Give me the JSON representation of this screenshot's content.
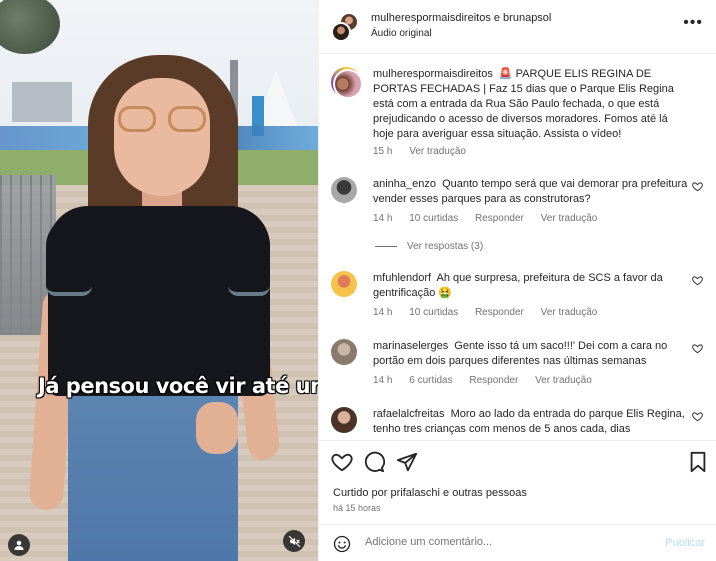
{
  "video": {
    "caption": "Já pensou você vir até um"
  },
  "header": {
    "names": "mulherespormaisdireitos e brunapsol",
    "audio": "Áudio original"
  },
  "post": {
    "username": "mulherespormaisdireitos",
    "caption": "🚨 PARQUE ELIS REGINA DE PORTAS FECHADAS | Faz 15 dias que o Parque Elis Regina está com a entrada da Rua São Paulo fechada, o que está prejudicando o acesso de diversos moradores. Fomos até lá hoje para averiguar essa situação. Assista o vídeo!",
    "time": "15 h",
    "translate": "Ver tradução"
  },
  "comments": [
    {
      "username": "aninha_enzo",
      "text": "Quanto tempo será que vai demorar pra prefeitura vender esses parques para as construtoras?",
      "time": "14 h",
      "likes": "10 curtidas",
      "reply": "Responder",
      "translate": "Ver tradução",
      "replies": "Ver respostas (3)"
    },
    {
      "username": "mfuhlendorf",
      "text": "Ah que surpresa, prefeitura de SCS a favor da gentrificação 🤮",
      "time": "14 h",
      "likes": "10 curtidas",
      "reply": "Responder",
      "translate": "Ver tradução"
    },
    {
      "username": "marinaselerges",
      "text": "Gente isso tá um saco!!!' Dei com a cara no portão em dois parques diferentes nas últimas semanas",
      "time": "14 h",
      "likes": "6 curtidas",
      "reply": "Responder",
      "translate": "Ver tradução"
    },
    {
      "username": "rafaelalcfreitas",
      "text": "Moro ao lado da entrada do parque Elis Regina, tenho tres crianças com menos de 5 anos cada, dias"
    }
  ],
  "actions": {
    "liked_by": "Curtido por prifalaschi e outras pessoas",
    "time": "há 15 horas"
  },
  "composer": {
    "placeholder": "Adicione um comentário...",
    "publish": "Publicar"
  },
  "colors": {
    "link_disabled": "#b2dffc",
    "secondary_text": "#737373",
    "divider": "#efefef"
  }
}
